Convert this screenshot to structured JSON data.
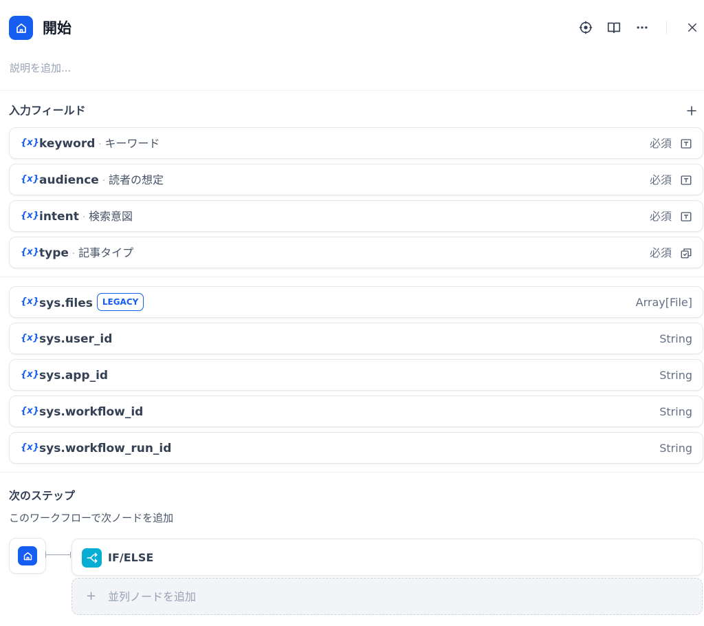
{
  "header": {
    "title": "開始",
    "description_placeholder": "説明を追加..."
  },
  "input_fields": {
    "title": "入力フィールド",
    "items": [
      {
        "name": "keyword",
        "label": "キーワード",
        "required": "必須",
        "type_icon": "text-input-icon"
      },
      {
        "name": "audience",
        "label": "読者の想定",
        "required": "必須",
        "type_icon": "text-input-icon"
      },
      {
        "name": "intent",
        "label": "検索意図",
        "required": "必須",
        "type_icon": "text-input-icon"
      },
      {
        "name": "type",
        "label": "記事タイプ",
        "required": "必須",
        "type_icon": "select-icon"
      }
    ]
  },
  "system_vars": [
    {
      "name": "sys.files",
      "badge": "LEGACY",
      "type": "Array[File]"
    },
    {
      "name": "sys.user_id",
      "type": "String"
    },
    {
      "name": "sys.app_id",
      "type": "String"
    },
    {
      "name": "sys.workflow_id",
      "type": "String"
    },
    {
      "name": "sys.workflow_run_id",
      "type": "String"
    }
  ],
  "next_step": {
    "title": "次のステップ",
    "subtitle": "このワークフローで次ノードを追加",
    "node_label": "IF/ELSE",
    "add_parallel_label": "並列ノードを追加"
  },
  "icons": {
    "var_icon_text": "{x}"
  },
  "colors": {
    "accent": "#155eef",
    "ifelse": "#06aed4"
  }
}
